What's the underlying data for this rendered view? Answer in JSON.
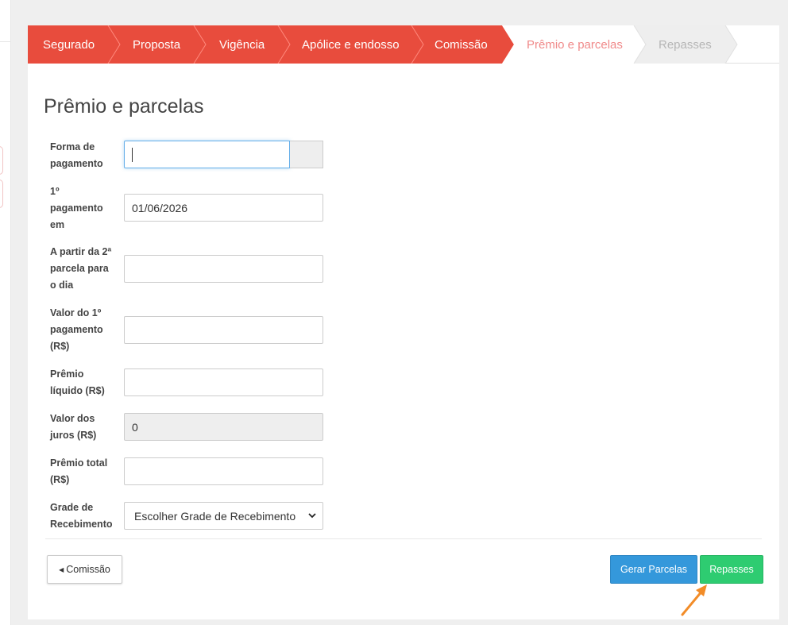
{
  "wizard": {
    "steps": [
      {
        "label": "Segurado",
        "state": "done"
      },
      {
        "label": "Proposta",
        "state": "done"
      },
      {
        "label": "Vigência",
        "state": "done"
      },
      {
        "label": "Apólice e endosso",
        "state": "done"
      },
      {
        "label": "Comissão",
        "state": "done"
      },
      {
        "label": "Prêmio e parcelas",
        "state": "current"
      },
      {
        "label": "Repasses",
        "state": "todo"
      }
    ],
    "colors": {
      "done": "#e84c3d",
      "current": "#ffffff",
      "todo": "#eeeeee"
    }
  },
  "page_title": "Prêmio e parcelas",
  "form": {
    "forma_pagamento": {
      "label": "Forma de pagamento",
      "value": ""
    },
    "primeiro_pagamento": {
      "label": "1º pagamento em",
      "value": "01/06/2026"
    },
    "segunda_parcela_dia": {
      "label": "A partir da 2ª parcela para o dia",
      "value": ""
    },
    "valor_primeiro_pagamento": {
      "label": "Valor do 1º pagamento (R$)",
      "value": ""
    },
    "premio_liquido": {
      "label": "Prêmio líquido (R$)",
      "value": ""
    },
    "valor_juros": {
      "label": "Valor dos juros (R$)",
      "value": "0"
    },
    "premio_total": {
      "label": "Prêmio total (R$)",
      "value": ""
    },
    "grade_recebimento": {
      "label": "Grade de Recebimento",
      "selected": "Escolher Grade de Recebimento"
    }
  },
  "actions": {
    "back_label": "Comissão",
    "gerar_label": "Gerar Parcelas",
    "repasses_label": "Repasses"
  },
  "annotation": {
    "color": "#f28c28",
    "icon": "arrow-pointer-icon"
  }
}
